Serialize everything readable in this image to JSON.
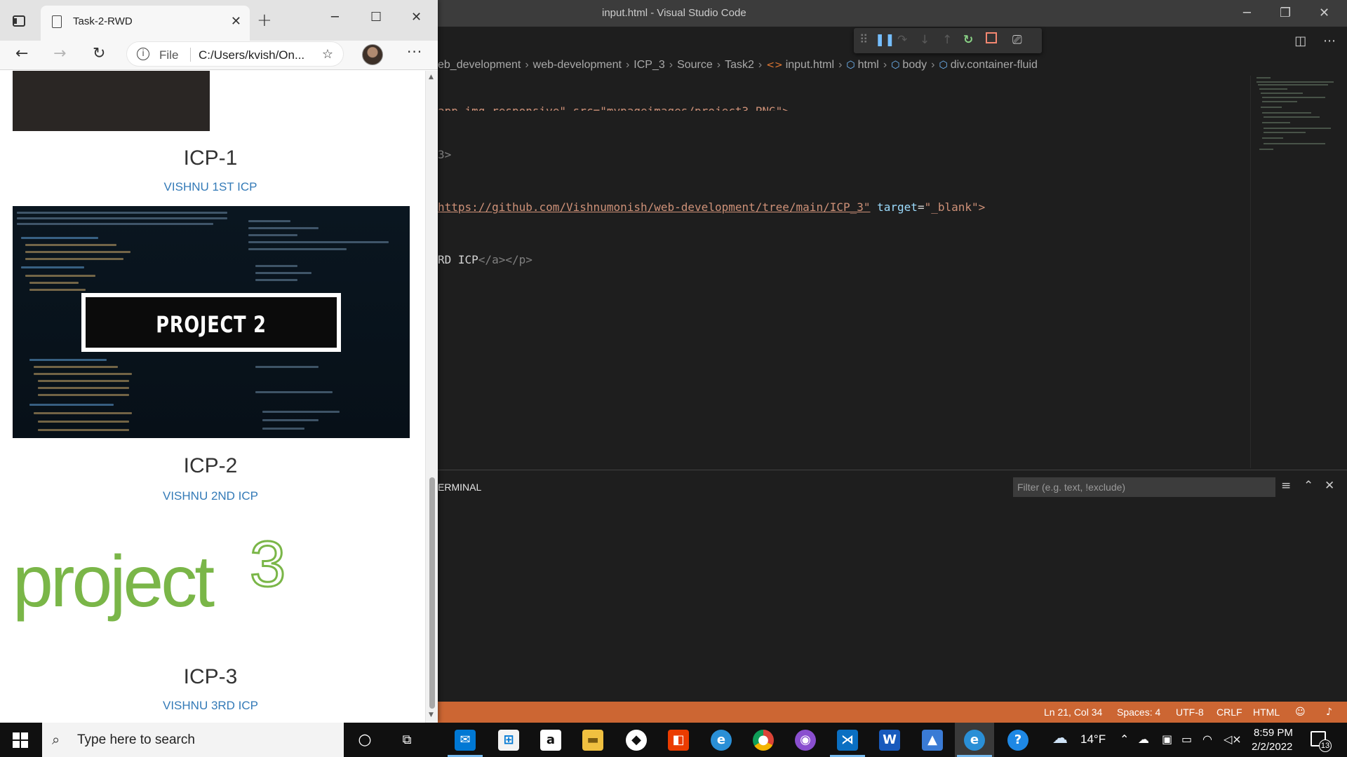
{
  "vscode": {
    "window_title": "input.html - Visual Studio Code",
    "breadcrumb": [
      "eb_development",
      "web-development",
      "ICP_3",
      "Source",
      "Task2",
      "input.html",
      "html",
      "body",
      "div.container-fluid"
    ],
    "code_line_1": "app img-responsive\" src=\"mypageimages/project3.PNG\">",
    "code_line_2": "3>",
    "code_line_3_url": "https://github.com/Vishnumonish/web-development/tree/main/ICP_3\"",
    "code_line_3_attr": "target",
    "code_line_3_val": "\"_blank\">",
    "code_line_4_text": "RD ICP",
    "code_line_4_tags": "</a></p>",
    "panel_tab": "ERMINAL",
    "filter_placeholder": "Filter (e.g. text, !exclude)",
    "status": {
      "position": "Ln 21, Col 34",
      "spaces": "Spaces: 4",
      "encoding": "UTF-8",
      "eol": "CRLF",
      "language": "HTML"
    }
  },
  "browser": {
    "tab_title": "Task-2-RWD",
    "address_scheme": "File",
    "address_url": "C:/Users/kvish/On...",
    "projects": [
      {
        "title": "ICP-1",
        "link": "VISHNU 1ST ICP"
      },
      {
        "title": "ICP-2",
        "link": "VISHNU 2ND ICP",
        "image_text": "PROJECT 2"
      },
      {
        "title": "ICP-3",
        "link": "VISHNU 3RD ICP",
        "image_word": "project",
        "image_digit": "3"
      }
    ]
  },
  "taskbar": {
    "search_placeholder": "Type here to search",
    "weather": "14°F",
    "time": "8:59 PM",
    "date": "2/2/2022",
    "notification_count": "13"
  },
  "colors": {
    "vscode_status_bar": "#cc6633",
    "link": "#337ab7",
    "project3_green": "#7ab648"
  }
}
